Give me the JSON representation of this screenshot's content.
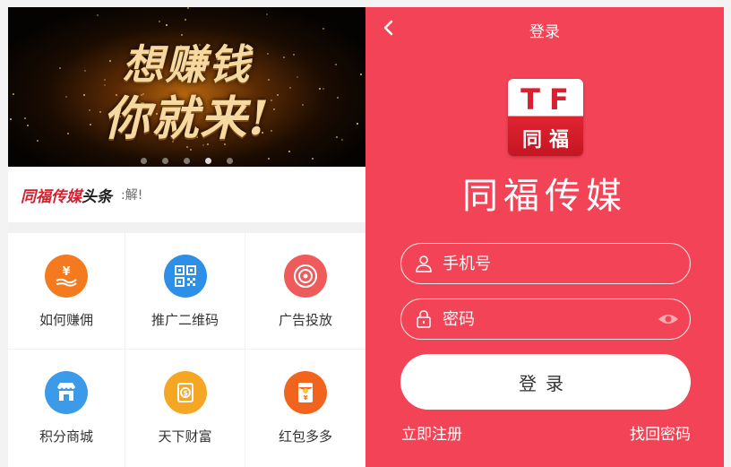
{
  "banner": {
    "line1": "想赚钱",
    "line2": "你就来!",
    "dots": [
      false,
      false,
      false,
      true,
      false
    ]
  },
  "news": {
    "brand": "同福传媒",
    "headline": "头条",
    "text": ":解!"
  },
  "grid": [
    {
      "label": "如何赚佣",
      "icon": "yen-hand-icon",
      "color": "#f47a1f"
    },
    {
      "label": "推广二维码",
      "icon": "qr-code-icon",
      "color": "#2d8fe6"
    },
    {
      "label": "广告投放",
      "icon": "target-icon",
      "color": "#ef5b5b"
    },
    {
      "label": "积分商城",
      "icon": "store-icon",
      "color": "#3b9be8"
    },
    {
      "label": "天下财富",
      "icon": "coins-icon",
      "color": "#f5a623"
    },
    {
      "label": "红包多多",
      "icon": "red-envelope-icon",
      "color": "#f0641e"
    }
  ],
  "login": {
    "title": "登录",
    "logo_top": "TF",
    "logo_bottom": "同福",
    "brand_name": "同福传媒",
    "phone_placeholder": "手机号",
    "password_placeholder": "密码",
    "login_button": "登录",
    "register_link": "立即注册",
    "forgot_link": "找回密码"
  },
  "colors": {
    "login_bg": "#f24456",
    "brand_red": "#d5202d"
  }
}
